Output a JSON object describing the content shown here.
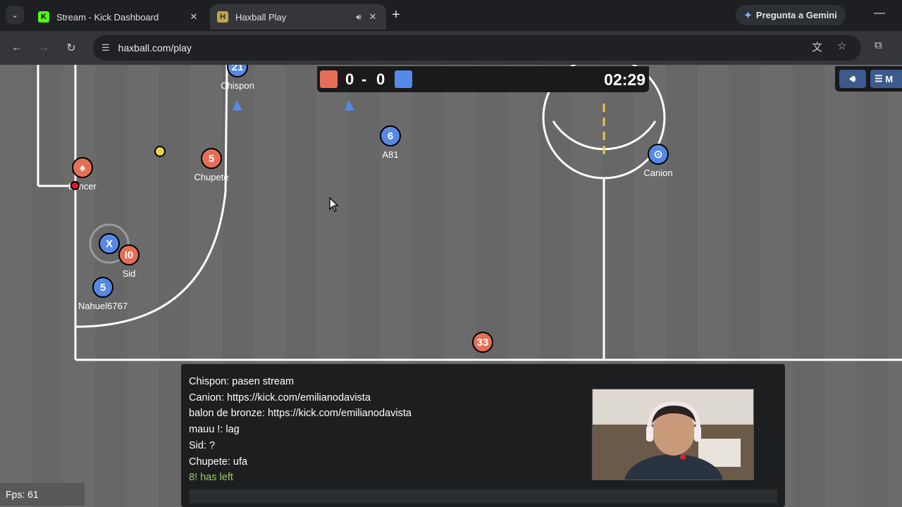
{
  "browser": {
    "tabs": [
      {
        "title": "Stream - Kick Dashboard",
        "favicon": "K"
      },
      {
        "title": "Haxball Play",
        "favicon": "H"
      }
    ],
    "gemini_label": "Pregunta a Gemini",
    "url": "haxball.com/play"
  },
  "score": {
    "red": "0",
    "separator": "-",
    "blue": "0",
    "time": "02:29"
  },
  "menu": {
    "label": "M"
  },
  "players": [
    {
      "name": "Chispon",
      "number": "21",
      "team": "blue"
    },
    {
      "name": "A81",
      "number": "6",
      "team": "blue"
    },
    {
      "name": "Canion",
      "number": "⊙",
      "team": "blue"
    },
    {
      "name": "Chupete",
      "number": "5",
      "team": "red"
    },
    {
      "name": "Lancer",
      "number": "♠",
      "team": "red"
    },
    {
      "name": "Sid",
      "number": "I0",
      "team": "red"
    },
    {
      "name": "",
      "number": "X",
      "team": "blue"
    },
    {
      "name": "Nahuel6767",
      "number": "5",
      "team": "blue"
    },
    {
      "name": "33",
      "number": "33",
      "team": "red"
    }
  ],
  "chat": {
    "messages": [
      "Chispon: pasen stream",
      "Canion: https://kick.com/emilianodavista",
      "balon de bronze: https://kick.com/emilianodavista",
      "mauu !: lag",
      "Sid: ?",
      "Chupete: ufa",
      "8! has left"
    ]
  },
  "fps": "Fps: 61",
  "colors": {
    "red_team": "#e56e56",
    "blue_team": "#5689e5",
    "pitch": "#6a6a6a"
  }
}
